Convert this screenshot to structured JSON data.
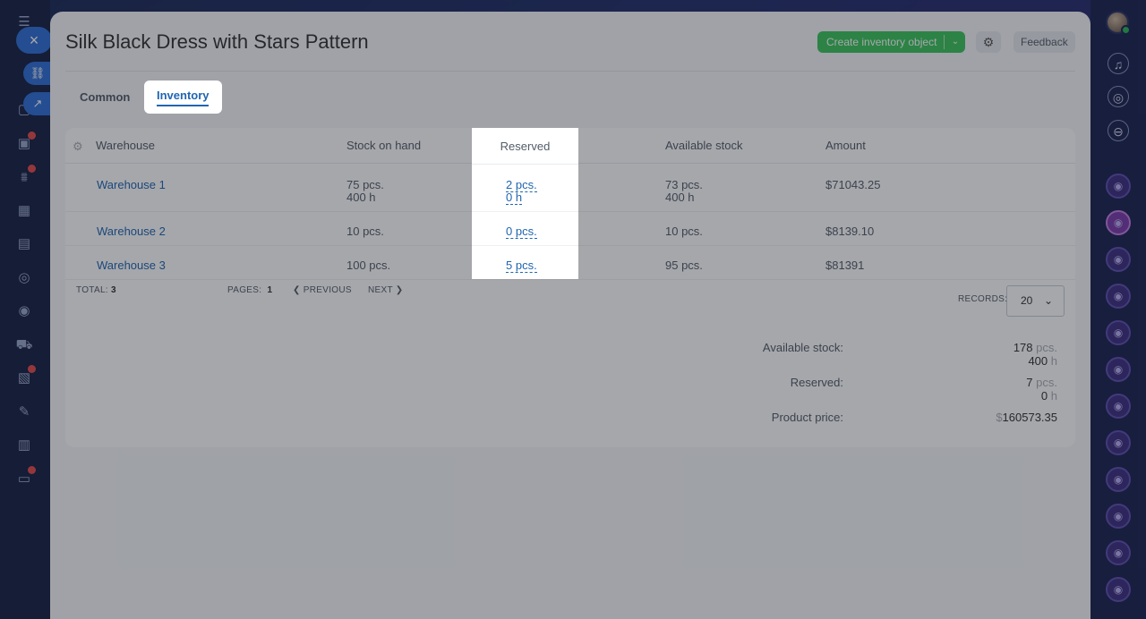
{
  "page": {
    "title": "Silk Black Dress with Stars Pattern",
    "create_label": "Create inventory object",
    "feedback_label": "Feedback"
  },
  "tabs": [
    {
      "label": "Common"
    },
    {
      "label": "Inventory",
      "active": true
    }
  ],
  "table": {
    "headers": {
      "warehouse": "Warehouse",
      "stock": "Stock on hand",
      "reserved": "Reserved",
      "available": "Available stock",
      "amount": "Amount"
    },
    "rows": [
      {
        "warehouse": "Warehouse 1",
        "stock": "75 pcs.",
        "stock_h": "400 h",
        "reserved": "2 pcs.",
        "reserved_h": "0 h",
        "available": "73 pcs.",
        "available_h": "400 h",
        "amount": "$71043.25"
      },
      {
        "warehouse": "Warehouse 2",
        "stock": "10 pcs.",
        "reserved": "0 pcs.",
        "available": "10 pcs.",
        "amount": "$8139.10"
      },
      {
        "warehouse": "Warehouse 3",
        "stock": "100 pcs.",
        "reserved": "5 pcs.",
        "available": "95 pcs.",
        "amount": "$81391"
      }
    ]
  },
  "pager": {
    "total_label": "TOTAL:",
    "total": "3",
    "pages_label": "PAGES:",
    "pages": "1",
    "prev": "PREVIOUS",
    "next": "NEXT",
    "records_label": "RECORDS:",
    "records_value": "20"
  },
  "summary": {
    "available_label": "Available stock:",
    "available_pcs": "178",
    "available_h": "400",
    "reserved_label": "Reserved:",
    "reserved_pcs": "7",
    "reserved_h": "0",
    "price_label": "Product price:",
    "price_currency": "$",
    "price_value": "160573.35",
    "unit_pcs": "pcs.",
    "unit_h": "h"
  },
  "colors": {
    "accent": "#2066b0",
    "create_button": "#3bc55b"
  }
}
